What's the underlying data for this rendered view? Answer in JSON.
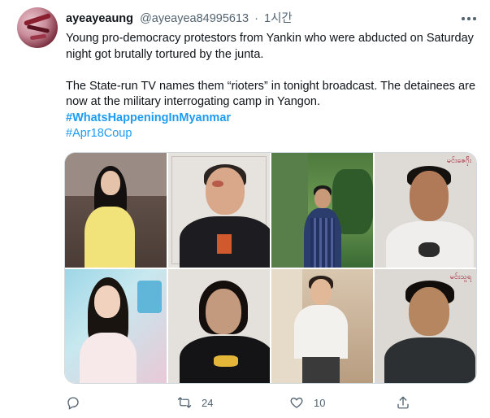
{
  "user": {
    "display_name": "ayeayeaung",
    "handle": "@ayeayea84995613",
    "separator": "·",
    "timestamp": "1시간"
  },
  "tweet": {
    "line1": "Young pro-democracy protestors from Yankin who were abducted on Saturday night got brutally tortured by the junta.",
    "line2": "The State-run TV names them “rioters” in tonight broadcast. The detainees are now at the military interrogating camp in Yangon.",
    "hashtag1": "#WhatsHappeningInMyanmar",
    "hashtag2": "#Apr18Coup"
  },
  "media": {
    "photo_count": 8,
    "photos": [
      {
        "label": ""
      },
      {
        "label": ""
      },
      {
        "label": ""
      },
      {
        "label": "မင်း‌ဇေဂ်ိုး"
      },
      {
        "label": ""
      },
      {
        "label": ""
      },
      {
        "label": ""
      },
      {
        "label": "မင်းသူရ"
      }
    ]
  },
  "actions": {
    "reply_count": "",
    "retweet_count": "24",
    "like_count": "10",
    "share_count": ""
  },
  "icons": {
    "more": "more-horizontal-icon",
    "reply": "reply-icon",
    "retweet": "retweet-icon",
    "like": "heart-icon",
    "share": "share-icon"
  },
  "colors": {
    "link": "#1d9bf0",
    "muted": "#536471",
    "text": "#0f1419"
  }
}
